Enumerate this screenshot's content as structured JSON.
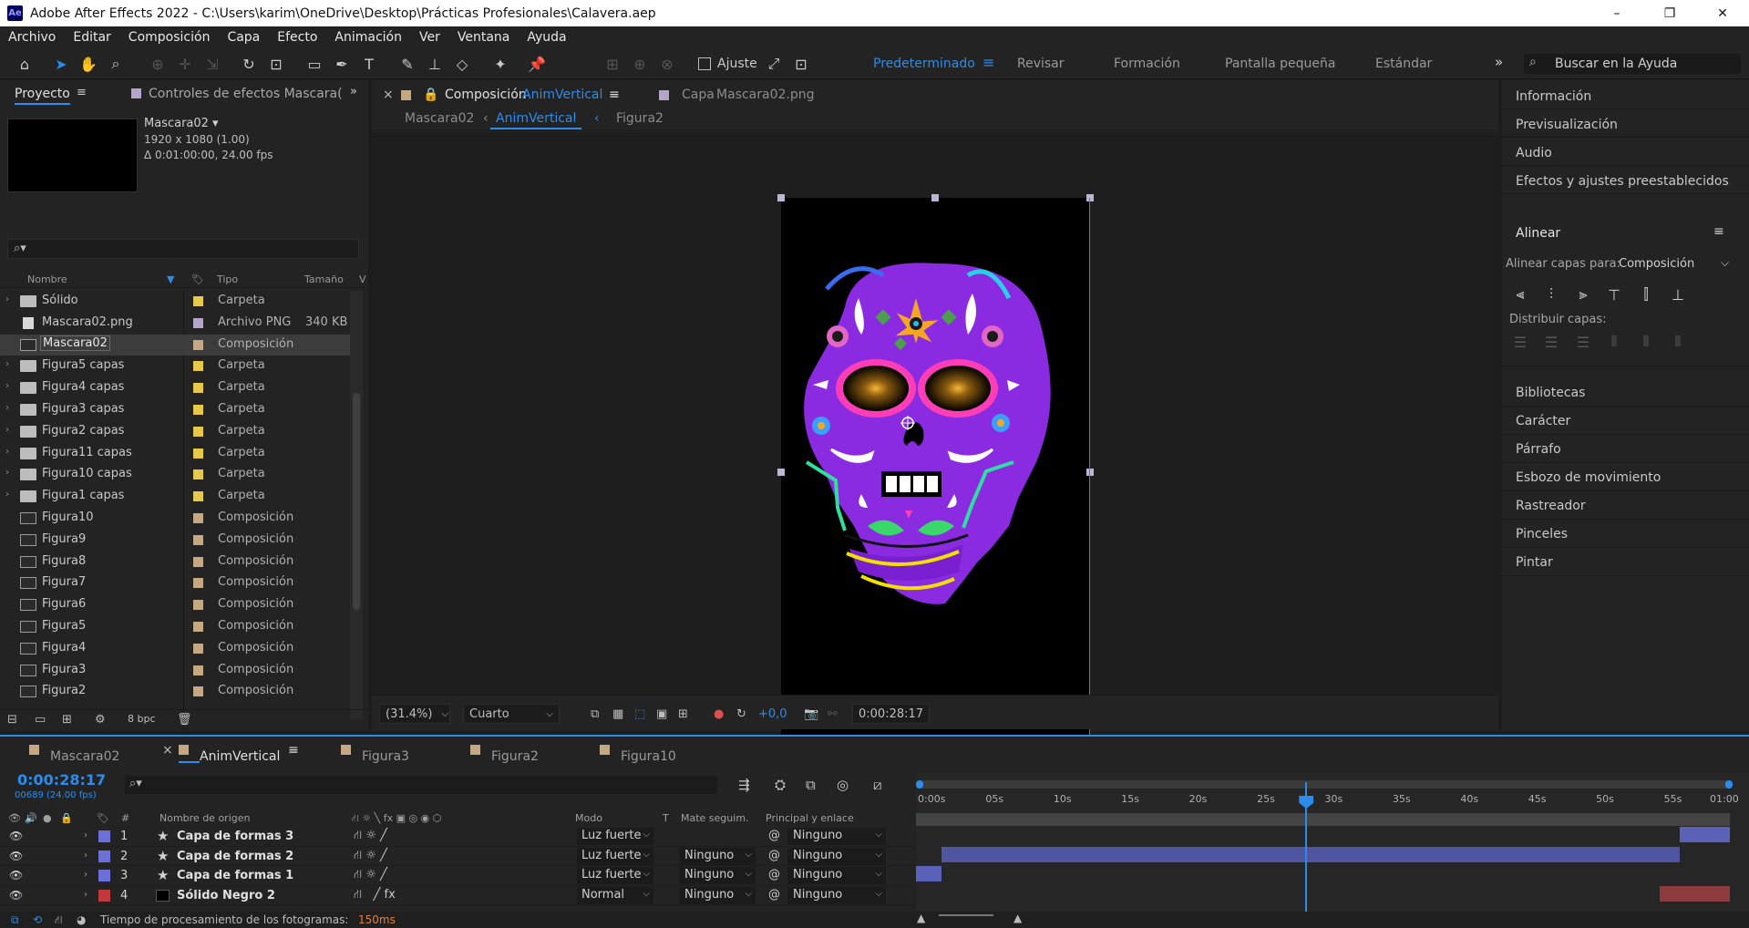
{
  "window": {
    "app_icon": "Ae",
    "title": "Adobe After Effects 2022 - C:\\Users\\karim\\OneDrive\\Desktop\\Prácticas Profesionales\\Calavera.aep",
    "min": "–",
    "max": "❐",
    "close": "✕"
  },
  "menu": [
    "Archivo",
    "Editar",
    "Composición",
    "Capa",
    "Efecto",
    "Animación",
    "Ver",
    "Ventana",
    "Ayuda"
  ],
  "toolbar": {
    "ajuste": "Ajuste",
    "workspaces": [
      "Predeterminado",
      "Revisar",
      "Formación",
      "Pantalla pequeña",
      "Estándar"
    ],
    "active_workspace": "Predeterminado",
    "more": "»",
    "help_placeholder": "Buscar en la Ayuda"
  },
  "project": {
    "tab_active": "Proyecto",
    "tab_effects": "Controles de efectos Mascara(",
    "more": "»",
    "selected_name": "Mascara02 ▾",
    "selected_dims": "1920 x 1080 (1.00)",
    "selected_duration": "Δ 0:01:00:00, 24.00 fps",
    "search_icon": "⌕▾",
    "col_name": "Nombre",
    "col_type": "Tipo",
    "col_size": "Tamaño",
    "col_v": "V",
    "bpc": "8 bpc",
    "items": [
      {
        "name": "Sólido",
        "type": "Carpeta",
        "size": "",
        "kind": "folder",
        "label": "#e6c84b",
        "twisty": "›"
      },
      {
        "name": "Mascara02.png",
        "type": "Archivo PNG",
        "size": "340 KB",
        "kind": "png",
        "label": "#b3a4c9",
        "twisty": ""
      },
      {
        "name": "Mascara02",
        "type": "Composición",
        "size": "",
        "kind": "comp",
        "label": "#c4a884",
        "twisty": "",
        "selected": true
      },
      {
        "name": "Figura5 capas",
        "type": "Carpeta",
        "size": "",
        "kind": "folder",
        "label": "#e6c84b",
        "twisty": "›"
      },
      {
        "name": "Figura4 capas",
        "type": "Carpeta",
        "size": "",
        "kind": "folder",
        "label": "#e6c84b",
        "twisty": "›"
      },
      {
        "name": "Figura3 capas",
        "type": "Carpeta",
        "size": "",
        "kind": "folder",
        "label": "#e6c84b",
        "twisty": "›"
      },
      {
        "name": "Figura2 capas",
        "type": "Carpeta",
        "size": "",
        "kind": "folder",
        "label": "#e6c84b",
        "twisty": "›"
      },
      {
        "name": "Figura11 capas",
        "type": "Carpeta",
        "size": "",
        "kind": "folder",
        "label": "#e6c84b",
        "twisty": "›"
      },
      {
        "name": "Figura10 capas",
        "type": "Carpeta",
        "size": "",
        "kind": "folder",
        "label": "#e6c84b",
        "twisty": "›"
      },
      {
        "name": "Figura1 capas",
        "type": "Carpeta",
        "size": "",
        "kind": "folder",
        "label": "#e6c84b",
        "twisty": "›"
      },
      {
        "name": "Figura10",
        "type": "Composición",
        "size": "",
        "kind": "comp",
        "label": "#c4a884",
        "twisty": ""
      },
      {
        "name": "Figura9",
        "type": "Composición",
        "size": "",
        "kind": "comp",
        "label": "#c4a884",
        "twisty": ""
      },
      {
        "name": "Figura8",
        "type": "Composición",
        "size": "",
        "kind": "comp",
        "label": "#c4a884",
        "twisty": ""
      },
      {
        "name": "Figura7",
        "type": "Composición",
        "size": "",
        "kind": "comp",
        "label": "#c4a884",
        "twisty": ""
      },
      {
        "name": "Figura6",
        "type": "Composición",
        "size": "",
        "kind": "comp",
        "label": "#c4a884",
        "twisty": ""
      },
      {
        "name": "Figura5",
        "type": "Composición",
        "size": "",
        "kind": "comp",
        "label": "#c4a884",
        "twisty": ""
      },
      {
        "name": "Figura4",
        "type": "Composición",
        "size": "",
        "kind": "comp",
        "label": "#c4a884",
        "twisty": ""
      },
      {
        "name": "Figura3",
        "type": "Composición",
        "size": "",
        "kind": "comp",
        "label": "#c4a884",
        "twisty": ""
      },
      {
        "name": "Figura2",
        "type": "Composición",
        "size": "",
        "kind": "comp",
        "label": "#c4a884",
        "twisty": ""
      }
    ]
  },
  "composition": {
    "close": "×",
    "tab_prefix": "Composición",
    "tab_name": "AnimVertical",
    "tab_layer": "Capa",
    "tab_layer_name": "Mascara02.png",
    "crumbs": [
      "Mascara02",
      "AnimVertical",
      "Figura2"
    ],
    "zoom": "(31.4%)",
    "resolution": "Cuarto",
    "exposure": "+0,0",
    "timecode": "0:00:28:17"
  },
  "right_panels": {
    "items": [
      "Información",
      "Previsualización",
      "Audio",
      "Efectos y ajustes preestablecidos"
    ],
    "align_title": "Alinear",
    "align_menu": "≡",
    "align_to_label": "Alinear capas para:",
    "align_to_value": "Composición",
    "distribute_label": "Distribuir capas:",
    "items_below": [
      "Bibliotecas",
      "Carácter",
      "Párrafo",
      "Esbozo de movimiento",
      "Rastreador",
      "Pinceles",
      "Pintar"
    ]
  },
  "timeline": {
    "tabs": [
      "Mascara02",
      "AnimVertical",
      "Figura3",
      "Figura2",
      "Figura10"
    ],
    "active_tab": "AnimVertical",
    "current_time": "0:00:28:17",
    "frames": "00689 (24.00 fps)",
    "col_num": "#",
    "col_name": "Nombre de origen",
    "col_mode": "Modo",
    "col_t": "T",
    "col_matte": "Mate seguim.",
    "col_parent": "Principal y enlace",
    "ruler": [
      "0:00s",
      "05s",
      "10s",
      "15s",
      "20s",
      "25s",
      "30s",
      "35s",
      "40s",
      "45s",
      "50s",
      "55s",
      "01:00"
    ],
    "duration_s": 60,
    "current_time_s": 28.71,
    "layers": [
      {
        "num": "1",
        "name": "Capa de formas 3",
        "color": "#6b6fd8",
        "mode": "Luz fuerte",
        "matte": "",
        "parent": "Ninguno",
        "kind": "shape",
        "bar_color": "#5a62b8",
        "in_s": 56.3,
        "out_s": 60
      },
      {
        "num": "2",
        "name": "Capa de formas 2",
        "color": "#6b6fd8",
        "mode": "Luz fuerte",
        "matte": "Ninguno",
        "parent": "Ninguno",
        "kind": "shape",
        "bar_color": "#4f559e",
        "in_s": 1.9,
        "out_s": 56.3
      },
      {
        "num": "3",
        "name": "Capa de formas 1",
        "color": "#6b6fd8",
        "mode": "Luz fuerte",
        "matte": "Ninguno",
        "parent": "Ninguno",
        "kind": "shape",
        "bar_color": "#5a62b8",
        "in_s": 0,
        "out_s": 1.9
      },
      {
        "num": "4",
        "name": "Sólido Negro 2",
        "color": "#c0393b",
        "mode": "Normal",
        "matte": "Ninguno",
        "parent": "Ninguno",
        "kind": "solid",
        "bar_color": "#8e3b3e",
        "in_s": 54.8,
        "out_s": 60
      }
    ],
    "status_label": "Tiempo de procesamiento de los fotogramas:",
    "status_value": "150ms"
  }
}
